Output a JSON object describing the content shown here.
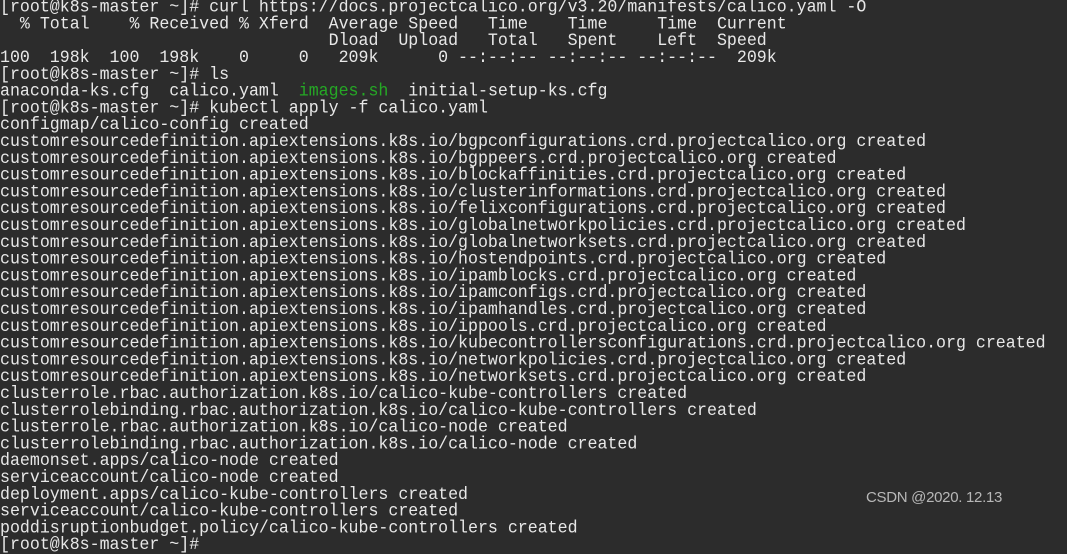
{
  "terminal": {
    "background": "#2c2c2c",
    "foreground": "#e8e8e8",
    "executable_color": "#25a825",
    "lines": [
      [
        {
          "t": "[root@k8s-master ~]# curl https://docs.projectcalico.org/v3.20/manifests/calico.yaml -O"
        }
      ],
      [
        {
          "t": "  % Total    % Received % Xferd  Average Speed   Time    Time     Time  Current"
        }
      ],
      [
        {
          "t": "                                 Dload  Upload   Total   Spent    Left  Speed"
        }
      ],
      [
        {
          "t": "100  198k  100  198k    0     0   209k      0 --:--:-- --:--:-- --:--:--  209k"
        }
      ],
      [
        {
          "t": "[root@k8s-master ~]# ls"
        }
      ],
      [
        {
          "t": "anaconda-ks.cfg  calico.yaml  "
        },
        {
          "t": "images.sh",
          "c": "green"
        },
        {
          "t": "  initial-setup-ks.cfg"
        }
      ],
      [
        {
          "t": "[root@k8s-master ~]# kubectl apply -f calico.yaml"
        }
      ],
      [
        {
          "t": "configmap/calico-config created"
        }
      ],
      [
        {
          "t": "customresourcedefinition.apiextensions.k8s.io/bgpconfigurations.crd.projectcalico.org created"
        }
      ],
      [
        {
          "t": "customresourcedefinition.apiextensions.k8s.io/bgppeers.crd.projectcalico.org created"
        }
      ],
      [
        {
          "t": "customresourcedefinition.apiextensions.k8s.io/blockaffinities.crd.projectcalico.org created"
        }
      ],
      [
        {
          "t": "customresourcedefinition.apiextensions.k8s.io/clusterinformations.crd.projectcalico.org created"
        }
      ],
      [
        {
          "t": "customresourcedefinition.apiextensions.k8s.io/felixconfigurations.crd.projectcalico.org created"
        }
      ],
      [
        {
          "t": "customresourcedefinition.apiextensions.k8s.io/globalnetworkpolicies.crd.projectcalico.org created"
        }
      ],
      [
        {
          "t": "customresourcedefinition.apiextensions.k8s.io/globalnetworksets.crd.projectcalico.org created"
        }
      ],
      [
        {
          "t": "customresourcedefinition.apiextensions.k8s.io/hostendpoints.crd.projectcalico.org created"
        }
      ],
      [
        {
          "t": "customresourcedefinition.apiextensions.k8s.io/ipamblocks.crd.projectcalico.org created"
        }
      ],
      [
        {
          "t": "customresourcedefinition.apiextensions.k8s.io/ipamconfigs.crd.projectcalico.org created"
        }
      ],
      [
        {
          "t": "customresourcedefinition.apiextensions.k8s.io/ipamhandles.crd.projectcalico.org created"
        }
      ],
      [
        {
          "t": "customresourcedefinition.apiextensions.k8s.io/ippools.crd.projectcalico.org created"
        }
      ],
      [
        {
          "t": "customresourcedefinition.apiextensions.k8s.io/kubecontrollersconfigurations.crd.projectcalico.org created"
        }
      ],
      [
        {
          "t": "customresourcedefinition.apiextensions.k8s.io/networkpolicies.crd.projectcalico.org created"
        }
      ],
      [
        {
          "t": "customresourcedefinition.apiextensions.k8s.io/networksets.crd.projectcalico.org created"
        }
      ],
      [
        {
          "t": "clusterrole.rbac.authorization.k8s.io/calico-kube-controllers created"
        }
      ],
      [
        {
          "t": "clusterrolebinding.rbac.authorization.k8s.io/calico-kube-controllers created"
        }
      ],
      [
        {
          "t": "clusterrole.rbac.authorization.k8s.io/calico-node created"
        }
      ],
      [
        {
          "t": "clusterrolebinding.rbac.authorization.k8s.io/calico-node created"
        }
      ],
      [
        {
          "t": "daemonset.apps/calico-node created"
        }
      ],
      [
        {
          "t": "serviceaccount/calico-node created"
        }
      ],
      [
        {
          "t": "deployment.apps/calico-kube-controllers created"
        }
      ],
      [
        {
          "t": "serviceaccount/calico-kube-controllers created"
        }
      ],
      [
        {
          "t": "poddisruptionbudget.policy/calico-kube-controllers created"
        }
      ],
      [
        {
          "t": "[root@k8s-master ~]#"
        }
      ]
    ]
  },
  "watermark": "CSDN @2020. 12.13"
}
